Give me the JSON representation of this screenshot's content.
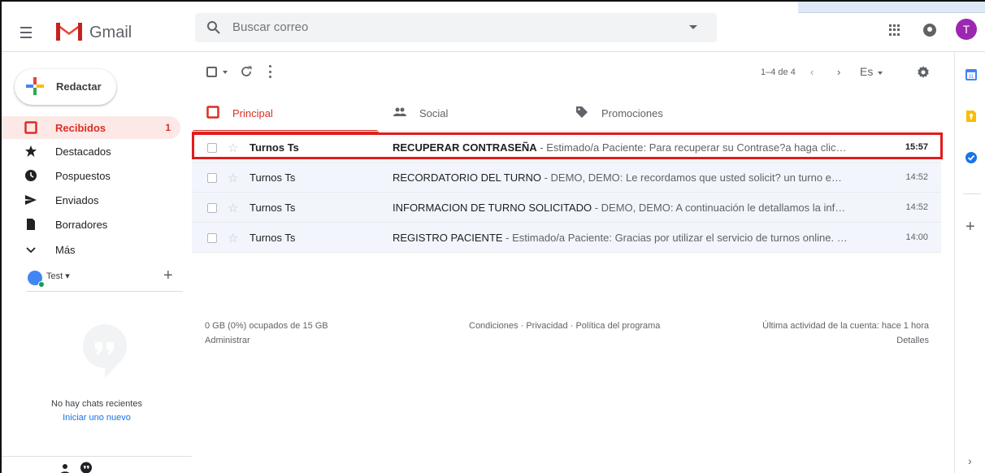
{
  "header": {
    "brand": "Gmail",
    "search_placeholder": "Buscar correo",
    "avatar_initial": "T"
  },
  "compose": {
    "label": "Redactar"
  },
  "nav": [
    {
      "label": "Recibidos",
      "count": "1",
      "icon": "inbox-icon",
      "active": true
    },
    {
      "label": "Destacados",
      "icon": "star-icon"
    },
    {
      "label": "Pospuestos",
      "icon": "clock-icon"
    },
    {
      "label": "Enviados",
      "icon": "send-icon"
    },
    {
      "label": "Borradores",
      "icon": "draft-icon"
    },
    {
      "label": "Más",
      "icon": "chevron-down-icon"
    }
  ],
  "chat": {
    "user": "Test",
    "empty": "No hay chats recientes",
    "start": "Iniciar uno nuevo"
  },
  "toolbar": {
    "page_count": "1–4 de 4",
    "language": "Es"
  },
  "tabs": [
    {
      "label": "Principal",
      "active": true
    },
    {
      "label": "Social"
    },
    {
      "label": "Promociones"
    }
  ],
  "emails": [
    {
      "sender": "Turnos Ts",
      "subject": "RECUPERAR CONTRASEÑA",
      "snippet": " - Estimado/a Paciente: Para recuperar su Contrase?a haga click en el s...",
      "time": "15:57",
      "unread": true,
      "highlighted": true
    },
    {
      "sender": "Turnos Ts",
      "subject": "RECORDATORIO DEL TURNO",
      "snippet": " - DEMO, DEMO: Le recordamos que usted solicit? un turno en HOSPIT...",
      "time": "14:52",
      "unread": false
    },
    {
      "sender": "Turnos Ts",
      "subject": "INFORMACION DE TURNO SOLICITADO",
      "snippet": " - DEMO, DEMO: A continuación le detallamos la informació...",
      "time": "14:52",
      "unread": false
    },
    {
      "sender": "Turnos Ts",
      "subject": "REGISTRO PACIENTE",
      "snippet": " - Estimado/a Paciente: Gracias por utilizar el servicio de turnos online. Para fi...",
      "time": "14:00",
      "unread": false
    }
  ],
  "footer": {
    "storage": "0 GB (0%) ocupados de 15 GB",
    "manage": "Administrar",
    "terms": "Condiciones · Privacidad · Política del programa",
    "last_activity": "Última actividad de la cuenta: hace 1 hora",
    "details": "Detalles"
  },
  "colors": {
    "accent": "#d93025",
    "highlight": "#e31b1b",
    "avatar": "#9c27b0",
    "link": "#1a73e8"
  }
}
